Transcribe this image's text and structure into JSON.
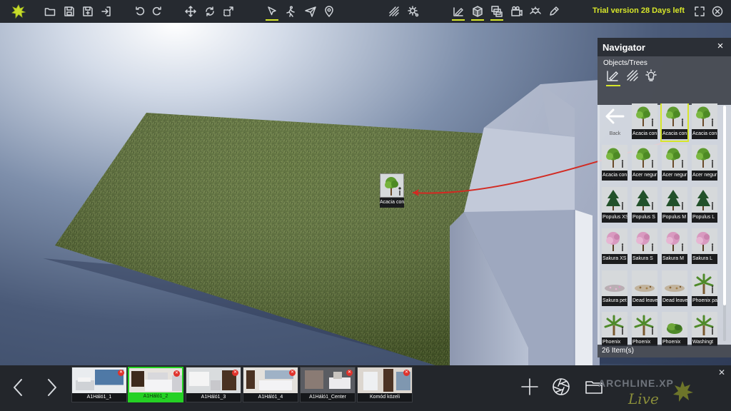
{
  "toolbar": {
    "trial_text": "Trial version 28 Days left",
    "accent_color": "#d7e62a",
    "icons": [
      "app-logo-icon",
      "open-folder-icon",
      "save-icon",
      "save-as-icon",
      "import-icon",
      "undo-icon",
      "redo-icon",
      "move-icon",
      "rotate-icon",
      "scale-icon",
      "select-pointer-icon",
      "walk-icon",
      "fly-icon",
      "location-pin-icon",
      "hatch-icon",
      "sun-settings-icon",
      "material-brush-icon",
      "object-cube-icon",
      "scene-images-icon",
      "camera-icon",
      "landscape-icon",
      "edit-pencil-icon",
      "fullscreen-icon",
      "close-icon"
    ],
    "active": [
      "select-pointer-icon",
      "material-brush-icon",
      "object-cube-icon",
      "scene-images-icon"
    ]
  },
  "viewport": {
    "dragged_item_label": "Acacia con"
  },
  "navigator": {
    "title": "Navigator",
    "path": "Objects/Trees",
    "tabs": [
      "brush-tab-icon",
      "hatch-tab-icon",
      "light-tab-icon"
    ],
    "active_tab": "brush-tab-icon",
    "back_label": "Back",
    "items": [
      {
        "label": "Acacia con",
        "kind": "tree"
      },
      {
        "label": "Acacia con",
        "kind": "tree",
        "selected": true
      },
      {
        "label": "Acacia con",
        "kind": "tree"
      },
      {
        "label": "Acacia con",
        "kind": "tree"
      },
      {
        "label": "Acer negur",
        "kind": "tree"
      },
      {
        "label": "Acer negur",
        "kind": "tree"
      },
      {
        "label": "Acer negur",
        "kind": "tree"
      },
      {
        "label": "Populus XS",
        "kind": "conifer"
      },
      {
        "label": "Populus S",
        "kind": "conifer"
      },
      {
        "label": "Populus M",
        "kind": "conifer"
      },
      {
        "label": "Populus L",
        "kind": "conifer"
      },
      {
        "label": "Sakura XS",
        "kind": "sakura"
      },
      {
        "label": "Sakura S",
        "kind": "sakura"
      },
      {
        "label": "Sakura M",
        "kind": "sakura"
      },
      {
        "label": "Sakura L",
        "kind": "sakura"
      },
      {
        "label": "Sakura pet",
        "kind": "petals"
      },
      {
        "label": "Dead leave",
        "kind": "leaves"
      },
      {
        "label": "Dead leave",
        "kind": "leaves"
      },
      {
        "label": "Phoenix pa",
        "kind": "palm"
      },
      {
        "label": "Phoenix",
        "kind": "palm"
      },
      {
        "label": "Phoenix",
        "kind": "palm"
      },
      {
        "label": "Phoenix",
        "kind": "bush"
      },
      {
        "label": "Washingt",
        "kind": "palm"
      }
    ],
    "item_count": "26 Item(s)"
  },
  "bottombar": {
    "scenes": [
      {
        "label": "A1Háló1_1",
        "active": false
      },
      {
        "label": "A1Háló1_2",
        "active": true
      },
      {
        "label": "A1Háló1_3",
        "active": false
      },
      {
        "label": "A1Háló1_4",
        "active": false
      },
      {
        "label": "A1Háló1_Center",
        "active": false
      },
      {
        "label": "Komód közeli",
        "active": false
      }
    ],
    "active_color": "#25d124",
    "brand": "ARCHLINE.XP Live",
    "buttons": [
      "add-scene-icon",
      "render-shutter-icon",
      "scene-folder-icon"
    ]
  }
}
